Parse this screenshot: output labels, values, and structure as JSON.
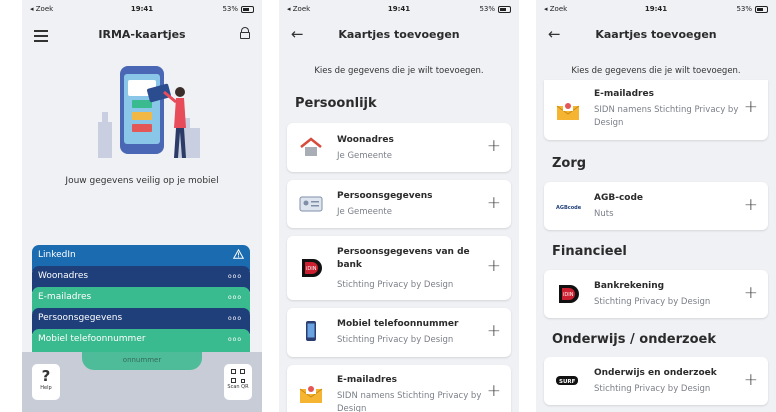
{
  "status": {
    "carrier": "◂ Zoek",
    "time": "19:41",
    "battery": "53%"
  },
  "screen1": {
    "title": "IRMA-kaartjes",
    "tagline": "Jouw gegevens veilig op je mobiel",
    "cards": [
      {
        "label": "LinkedIn",
        "badge": "⚠"
      },
      {
        "label": "Woonadres",
        "badge": "ooo"
      },
      {
        "label": "E-mailadres",
        "badge": "ooo"
      },
      {
        "label": "Persoonsgegevens",
        "badge": "ooo"
      },
      {
        "label": "Mobiel telefoonnummer",
        "badge": "ooo"
      }
    ],
    "peek_label": "onnummer",
    "help_label": "Help",
    "help_glyph": "?",
    "scan_label": "Scan QR"
  },
  "screen2": {
    "title": "Kaartjes toevoegen",
    "intro": "Kies de gegevens die je wilt toevoegen.",
    "section": "Persoonlijk",
    "items": [
      {
        "name": "Woonadres",
        "issuer": "Je Gemeente",
        "icon": "house-icon"
      },
      {
        "name": "Persoonsgegevens",
        "issuer": "Je Gemeente",
        "icon": "id-card-icon"
      },
      {
        "name": "Persoonsgegevens van de bank",
        "issuer": "Stichting Privacy by Design",
        "icon": "idin-icon"
      },
      {
        "name": "Mobiel telefoonnummer",
        "issuer": "Stichting Privacy by Design",
        "icon": "phone-icon"
      },
      {
        "name": "E-mailadres",
        "issuer": "SIDN namens Stichting Privacy by Design",
        "icon": "envelope-icon"
      }
    ]
  },
  "screen3": {
    "title": "Kaartjes toevoegen",
    "intro": "Kies de gegevens die je wilt toevoegen.",
    "email_item": {
      "name": "E-mailadres",
      "issuer": "SIDN namens Stichting Privacy by Design"
    },
    "sections": [
      {
        "title": "Zorg",
        "item": {
          "name": "AGB-code",
          "issuer": "Nuts",
          "logo": "AGBcode"
        }
      },
      {
        "title": "Financieel",
        "item": {
          "name": "Bankrekening",
          "issuer": "Stichting Privacy by Design"
        }
      },
      {
        "title": "Onderwijs / onderzoek",
        "item": {
          "name": "Onderwijs en onderzoek",
          "issuer": "Stichting Privacy by Design",
          "logo": "SURF"
        }
      }
    ]
  },
  "plus": "+",
  "back": "←",
  "colors": {
    "blue": "#1f3f7a",
    "linkedin": "#1b6bb0",
    "green": "#3aba8f",
    "house": "#d64b3b",
    "idin": "#cc1f30"
  }
}
